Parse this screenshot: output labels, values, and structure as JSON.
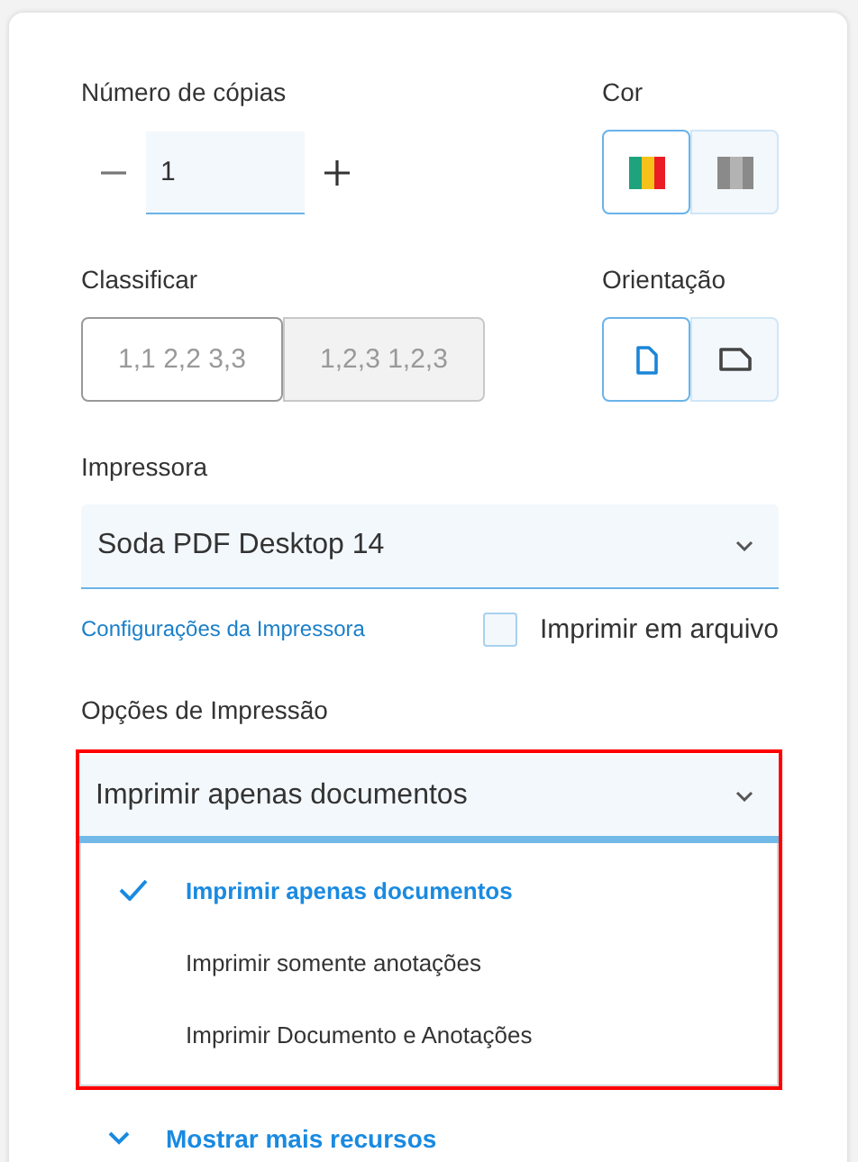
{
  "copies": {
    "label": "Número de cópias",
    "value": "1"
  },
  "color": {
    "label": "Cor",
    "options": [
      {
        "kind": "color",
        "selected": true
      },
      {
        "kind": "grayscale",
        "selected": false
      }
    ]
  },
  "collate": {
    "label": "Classificar",
    "options": [
      {
        "label": "1,1 2,2 3,3",
        "selected": true
      },
      {
        "label": "1,2,3 1,2,3",
        "selected": false
      }
    ]
  },
  "orientation": {
    "label": "Orientação",
    "options": [
      {
        "kind": "portrait",
        "selected": true
      },
      {
        "kind": "landscape",
        "selected": false
      }
    ]
  },
  "printer": {
    "label": "Impressora",
    "value": "Soda PDF Desktop 14",
    "settings_link": "Configurações da Impressora",
    "print_to_file": {
      "label": "Imprimir em arquivo",
      "checked": false
    }
  },
  "print_options": {
    "label": "Opções de Impressão",
    "value": "Imprimir apenas documentos",
    "expanded": true,
    "highlighted": true,
    "items": [
      {
        "label": "Imprimir apenas documentos",
        "selected": true
      },
      {
        "label": "Imprimir somente anotações",
        "selected": false
      },
      {
        "label": "Imprimir Documento e Anotações",
        "selected": false
      }
    ]
  },
  "more": {
    "label": "Mostrar mais recursos"
  }
}
